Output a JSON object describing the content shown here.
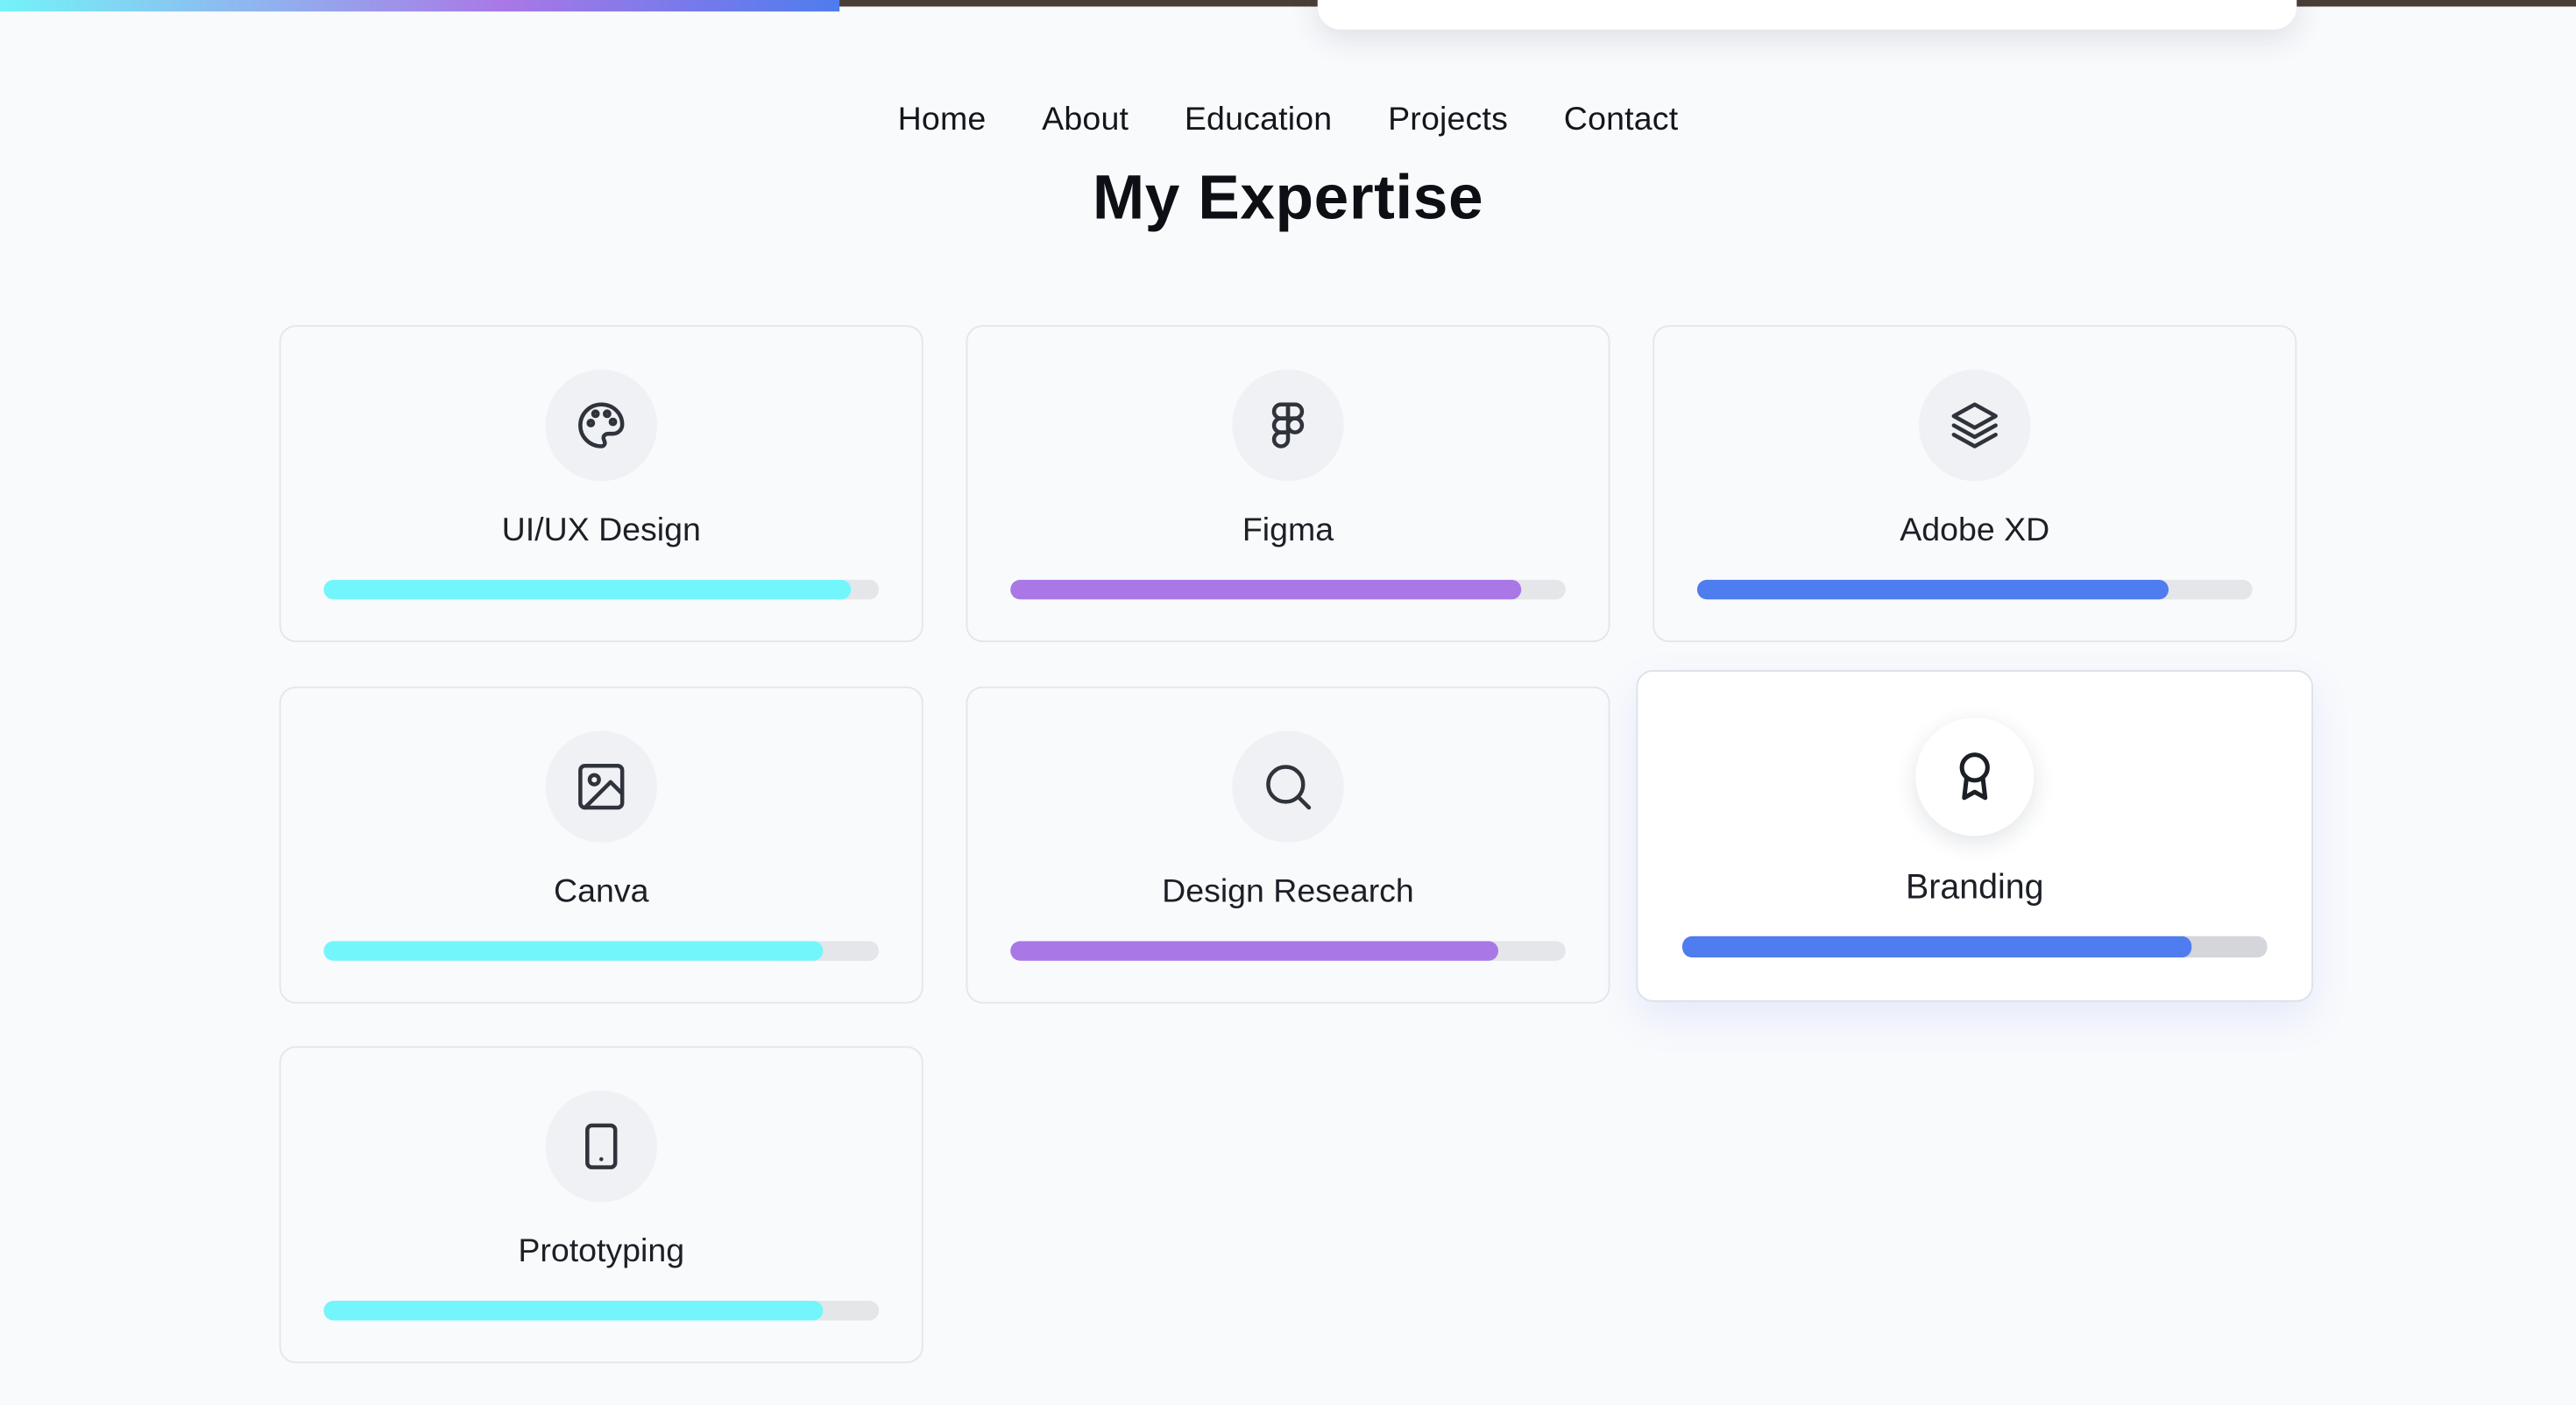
{
  "nav": {
    "items": [
      "Home",
      "About",
      "Education",
      "Projects",
      "Contact"
    ]
  },
  "page_scroll_progress": 0.326,
  "section": {
    "title": "My Expertise"
  },
  "skills": [
    {
      "label": "UI/UX Design",
      "icon": "palette-icon",
      "level": 0.95,
      "color": "#73f6fb"
    },
    {
      "label": "Figma",
      "icon": "figma-icon",
      "level": 0.92,
      "color": "#a978e6"
    },
    {
      "label": "Adobe XD",
      "icon": "layers-icon",
      "level": 0.85,
      "color": "#4f7cee"
    },
    {
      "label": "Canva",
      "icon": "image-icon",
      "level": 0.9,
      "color": "#73f6fb"
    },
    {
      "label": "Design Research",
      "icon": "search-icon",
      "level": 0.88,
      "color": "#a978e6"
    },
    {
      "label": "Branding",
      "icon": "award-icon",
      "level": 0.87,
      "color": "#4f7cee"
    },
    {
      "label": "Prototyping",
      "icon": "tablet-icon",
      "level": 0.9,
      "color": "#73f6fb"
    }
  ],
  "colors": {
    "background": "#f9fafc",
    "cyan": "#73f6fb",
    "purple": "#a978e6",
    "blue": "#4f7cee"
  }
}
